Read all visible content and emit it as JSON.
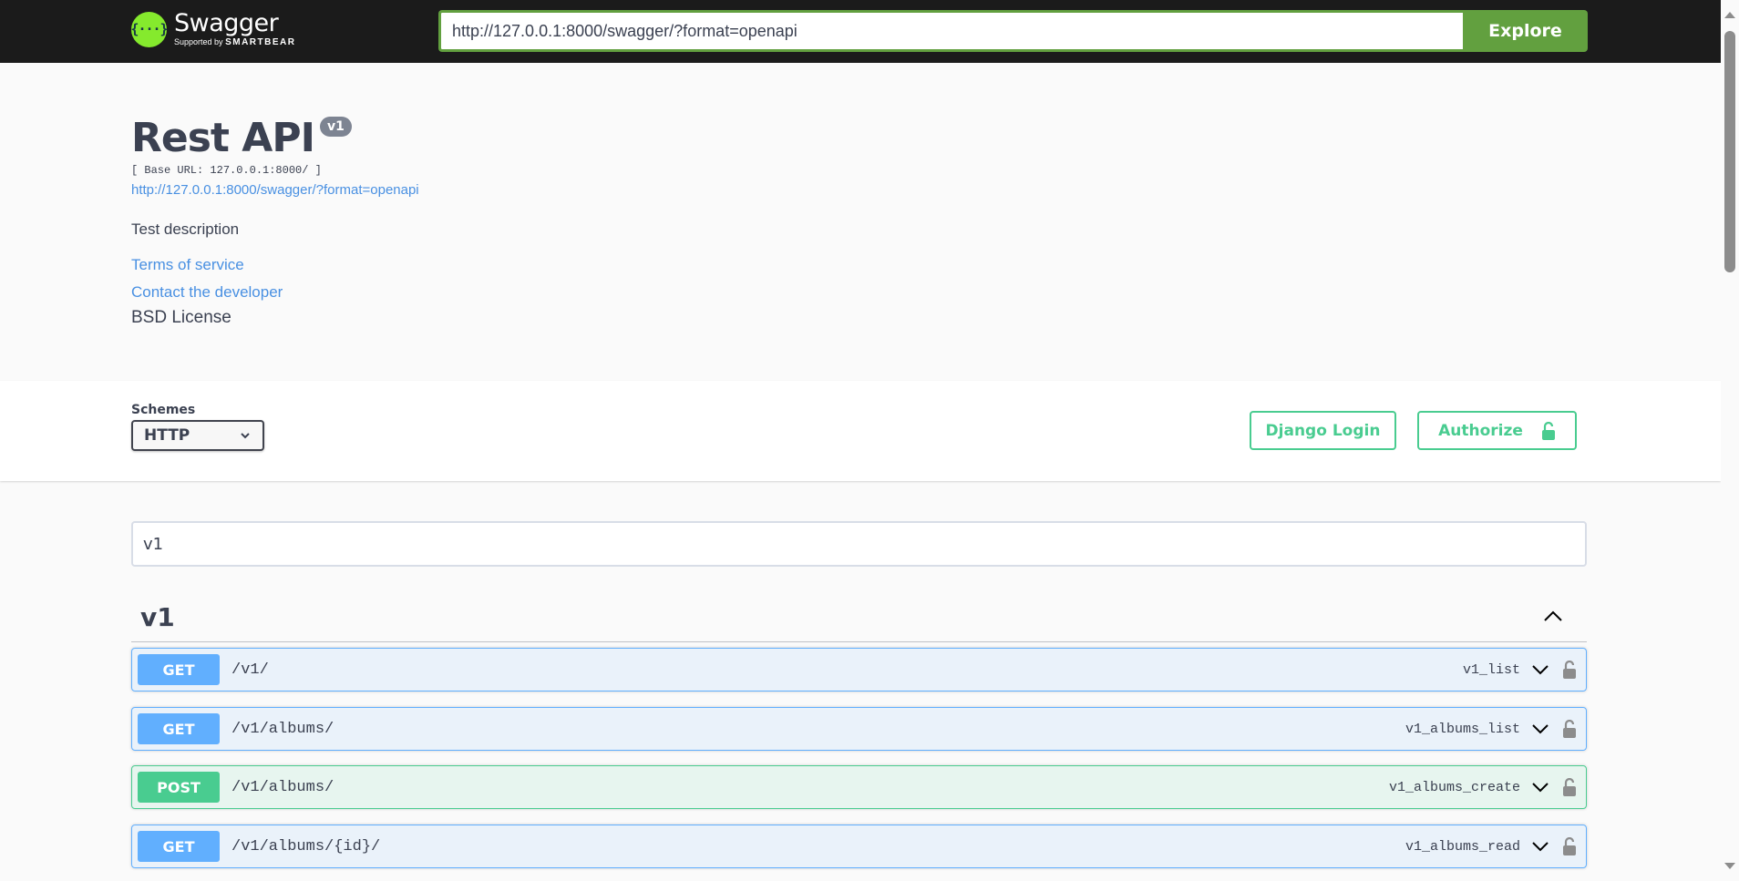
{
  "topbar": {
    "logo_glyph": "{···}",
    "logo_title": "Swagger",
    "logo_supported_by": "Supported by",
    "logo_brand": "SMARTBEAR",
    "url_value": "http://127.0.0.1:8000/swagger/?format=openapi",
    "explore_label": "Explore",
    "accent": "#62a03f"
  },
  "info": {
    "title": "Rest API",
    "version": "v1",
    "base_url": "[ Base URL: 127.0.0.1:8000/ ]",
    "spec_link": "http://127.0.0.1:8000/swagger/?format=openapi",
    "description": "Test description",
    "terms_link": "Terms of service",
    "contact_link": "Contact the developer",
    "license": "BSD License"
  },
  "schemes": {
    "label": "Schemes",
    "selected": "HTTP",
    "django_login_label": "Django Login",
    "authorize_label": "Authorize"
  },
  "filter": {
    "value": "v1"
  },
  "tag": {
    "name": "v1",
    "expanded": true
  },
  "operations": [
    {
      "method": "GET",
      "path": "/v1/",
      "operation_id": "v1_list"
    },
    {
      "method": "GET",
      "path": "/v1/albums/",
      "operation_id": "v1_albums_list"
    },
    {
      "method": "POST",
      "path": "/v1/albums/",
      "operation_id": "v1_albums_create"
    },
    {
      "method": "GET",
      "path": "/v1/albums/{id}/",
      "operation_id": "v1_albums_read"
    }
  ],
  "colors": {
    "get": "#61affe",
    "post": "#49cc90",
    "link": "#4990e2",
    "text": "#3b4151"
  }
}
